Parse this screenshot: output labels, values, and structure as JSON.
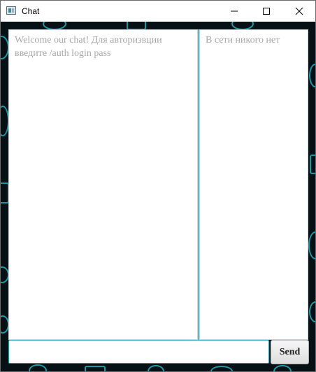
{
  "window": {
    "title": "Chat",
    "app_icon": "java-app-icon",
    "controls": {
      "minimize_icon": "minimize-icon",
      "maximize_icon": "maximize-icon",
      "close_icon": "close-icon"
    }
  },
  "chat": {
    "background_accent": "#1fb3c0",
    "messages_text": "Welcome our chat! Для авторизвции введите /auth login pass",
    "users_text": "В сети никого нет",
    "input": {
      "value": "",
      "placeholder": ""
    },
    "send_label": "Send"
  }
}
